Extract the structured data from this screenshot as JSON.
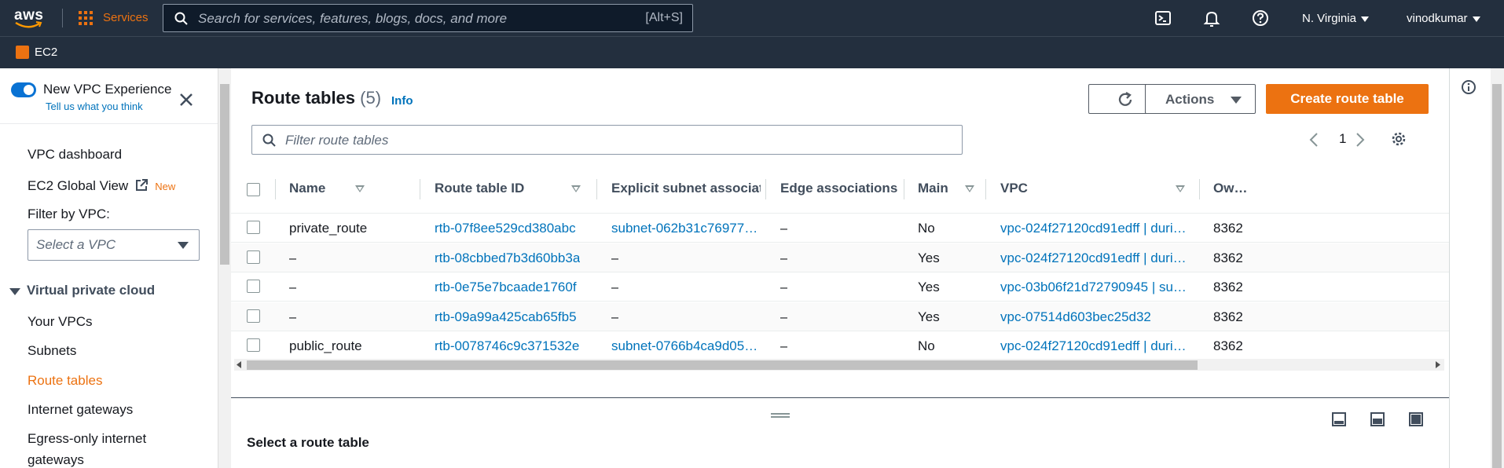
{
  "topnav": {
    "logo_text": "aws",
    "services_label": "Services",
    "search_placeholder": "Search for services, features, blogs, docs, and more",
    "search_shortcut": "[Alt+S]",
    "region": "N. Virginia",
    "user": "vinodkumar"
  },
  "subnav": {
    "service": "EC2"
  },
  "sidebar": {
    "toggle_label": "New VPC Experience",
    "feedback_link": "Tell us what you think",
    "links": [
      "VPC dashboard",
      "EC2 Global View"
    ],
    "new_tag": "New",
    "filter_label": "Filter by VPC:",
    "filter_placeholder": "Select a VPC",
    "section": "Virtual private cloud",
    "section_items": [
      "Your VPCs",
      "Subnets",
      "Route tables",
      "Internet gateways",
      "Egress-only internet",
      "gateways"
    ],
    "active_item": "Route tables"
  },
  "main": {
    "title": "Route tables",
    "count": "(5)",
    "info": "Info",
    "actions_label": "Actions",
    "create_label": "Create route table",
    "filter_placeholder": "Filter route tables",
    "page": "1",
    "columns": [
      "Name",
      "Route table ID",
      "Explicit subnet associat…",
      "Edge associations",
      "Main",
      "VPC",
      "Ow…"
    ],
    "rows": [
      [
        "private_route",
        "rtb-07f8ee529cd380abc",
        "subnet-062b31c769779…",
        "–",
        "No",
        "vpc-024f27120cd91edff | duri…",
        "8362"
      ],
      [
        "–",
        "rtb-08cbbed7b3d60bb3a",
        "–",
        "–",
        "Yes",
        "vpc-024f27120cd91edff | duri…",
        "8362"
      ],
      [
        "–",
        "rtb-0e75e7bcaade1760f",
        "–",
        "–",
        "Yes",
        "vpc-03b06f21d72790945 | su…",
        "8362"
      ],
      [
        "–",
        "rtb-09a99a425cab65fb5",
        "–",
        "–",
        "Yes",
        "vpc-07514d603bec25d32",
        "8362"
      ],
      [
        "public_route",
        "rtb-0078746c9c371532e",
        "subnet-0766b4ca9d057…",
        "–",
        "No",
        "vpc-024f27120cd91edff | duri…",
        "8362"
      ]
    ],
    "detail_title": "Select a route table"
  },
  "colors": {
    "nav_bg": "#232f3e",
    "accent": "#ec7211",
    "link": "#0073bb",
    "toggle": "#0972d3"
  }
}
